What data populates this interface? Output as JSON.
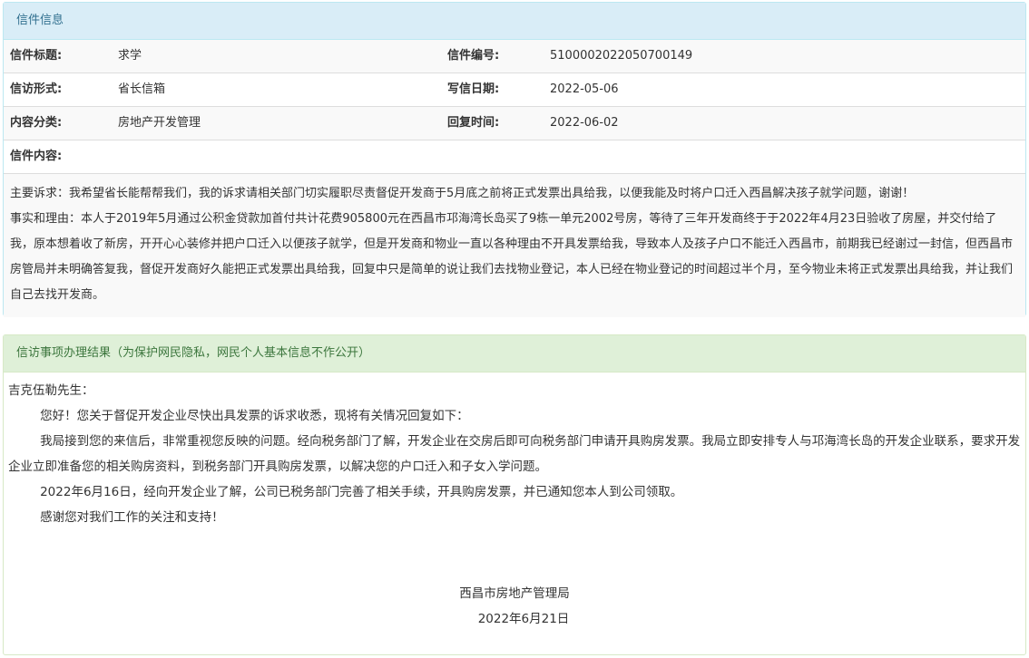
{
  "letter": {
    "header": "信件信息",
    "rows": [
      {
        "l1": "信件标题:",
        "v1": "求学",
        "l2": "信件编号:",
        "v2": "5100002022050700149"
      },
      {
        "l1": "信访形式:",
        "v1": "省长信箱",
        "l2": "写信日期:",
        "v2": "2022-05-06"
      },
      {
        "l1": "内容分类:",
        "v1": "房地产开发管理",
        "l2": "回复时间:",
        "v2": "2022-06-02"
      }
    ],
    "content_label": "信件内容:",
    "content_lines": [
      "主要诉求：我希望省长能帮帮我们，我的诉求请相关部门切实履职尽责督促开发商于5月底之前将正式发票出具给我，以便我能及时将户口迁入西昌解决孩子就学问题，谢谢！",
      "事实和理由：本人于2019年5月通过公积金贷款加首付共计花费905800元在西昌市邛海湾长岛买了9栋一单元2002号房，等待了三年开发商终于于2022年4月23日验收了房屋，并交付给了我，原本想着收了新房，开开心心装修并把户口迁入以便孩子就学，但是开发商和物业一直以各种理由不开具发票给我，导致本人及孩子户口不能迁入西昌市，前期我已经谢过一封信，但西昌市房管局并未明确答复我，督促开发商好久能把正式发票出具给我，回复中只是简单的说让我们去找物业登记，本人已经在物业登记的时间超过半个月，至今物业未将正式发票出具给我，并让我们自己去找开发商。"
    ]
  },
  "result": {
    "header": "信访事项办理结果（为保护网民隐私，网民个人基本信息不作公开）",
    "salutation": "吉克伍勒先生：",
    "paragraphs": [
      "您好！您关于督促开发企业尽快出具发票的诉求收悉，现将有关情况回复如下：",
      "我局接到您的来信后，非常重视您反映的问题。经向税务部门了解，开发企业在交房后即可向税务部门申请开具购房发票。我局立即安排专人与邛海湾长岛的开发企业联系，要求开发企业立即准备您的相关购房资料，到税务部门开具购房发票，以解决您的户口迁入和子女入学问题。",
      "2022年6月16日，经向开发企业了解，公司已税务部门完善了相关手续，开具购房发票，并已通知您本人到公司领取。",
      "感谢您对我们工作的关注和支持！"
    ],
    "signature": "西昌市房地产管理局",
    "date": "2022年6月21日"
  },
  "colors": {
    "info_header_bg": "#d9edf7",
    "info_header_text": "#31708f",
    "result_header_bg": "#dff0d8",
    "result_header_text": "#3c763d"
  }
}
